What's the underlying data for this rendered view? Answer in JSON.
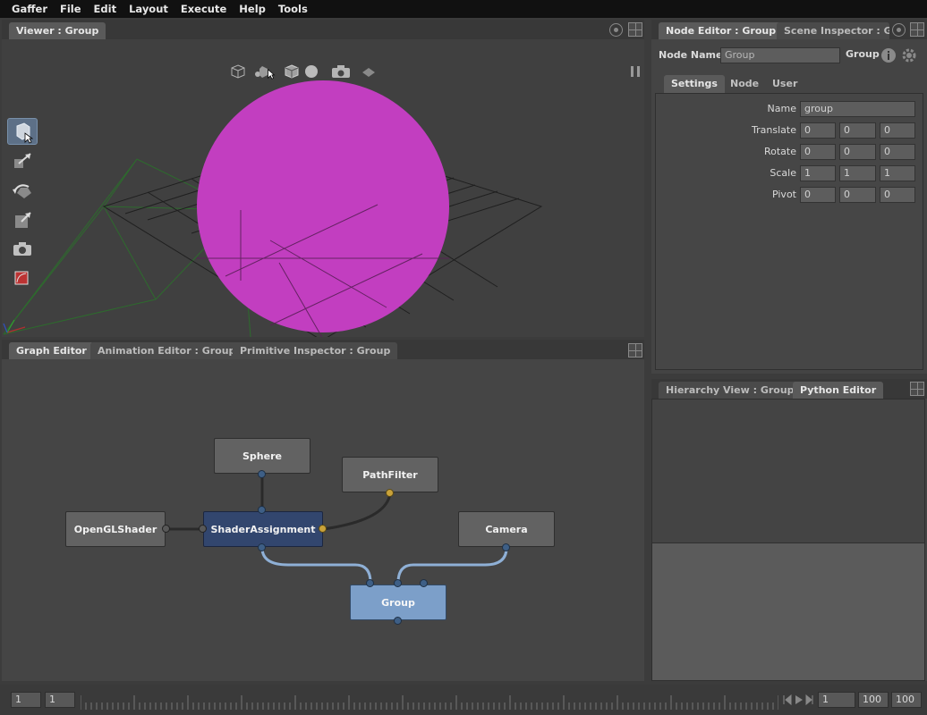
{
  "menubar": [
    "Gaffer",
    "File",
    "Edit",
    "Layout",
    "Execute",
    "Help",
    "Tools"
  ],
  "viewer": {
    "tab": "Viewer : Group",
    "toolbar_icons": [
      "object-icon",
      "shape-icon",
      "wireframe-cube-icon",
      "sphere-shading-icon",
      "camera-icon",
      "layers-icon"
    ],
    "tools": [
      "select-tool-icon",
      "translate-tool-icon",
      "rotate-tool-icon",
      "scale-tool-icon",
      "camera-tool-icon",
      "crop-window-tool-icon"
    ]
  },
  "graph_editor": {
    "tabs": [
      "Graph Editor",
      "Animation Editor : Group",
      "Primitive Inspector : Group"
    ],
    "nodes": {
      "sphere": "Sphere",
      "pathfilter": "PathFilter",
      "openglshader": "OpenGLShader",
      "shaderassignment": "ShaderAssignment",
      "camera": "Camera",
      "group": "Group"
    }
  },
  "node_editor": {
    "tabs": [
      "Node Editor : Group",
      "Scene Inspector : Group"
    ],
    "node_name_label": "Node Name",
    "node_name_value": "Group",
    "node_type": "Group",
    "subtabs": [
      "Settings",
      "Node",
      "User"
    ],
    "fields": {
      "name_label": "Name",
      "name_value": "group",
      "translate_label": "Translate",
      "translate": [
        "0",
        "0",
        "0"
      ],
      "rotate_label": "Rotate",
      "rotate": [
        "0",
        "0",
        "0"
      ],
      "scale_label": "Scale",
      "scale": [
        "1",
        "1",
        "1"
      ],
      "pivot_label": "Pivot",
      "pivot": [
        "0",
        "0",
        "0"
      ]
    }
  },
  "lower_right": {
    "tabs": [
      "Hierarchy View : Group",
      "Python Editor"
    ]
  },
  "timeline": {
    "start": "1",
    "current_left": "1",
    "current_right": "1",
    "end": "100",
    "range_end": "100"
  },
  "colors": {
    "sphere": "#c23ec0",
    "selected_node": "#32466e",
    "group_node": "#7c9fc9",
    "connection": "#8fb0d6",
    "frame_marker": "#e7d33c"
  }
}
